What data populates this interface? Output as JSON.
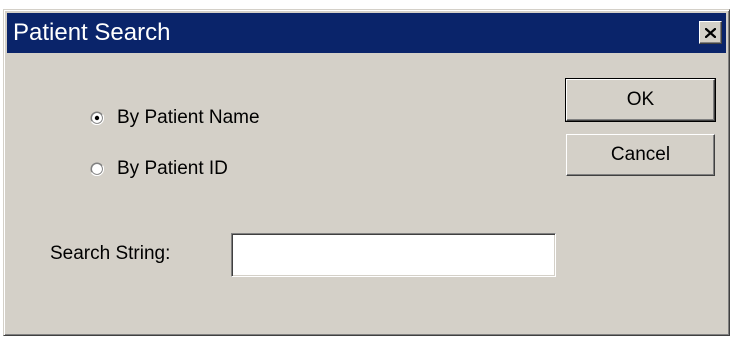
{
  "window": {
    "title": "Patient Search",
    "close_icon": "close-icon"
  },
  "search_mode": {
    "options": [
      {
        "label": "By Patient Name",
        "selected": true
      },
      {
        "label": "By Patient ID",
        "selected": false
      }
    ]
  },
  "search": {
    "label": "Search String:",
    "value": "",
    "placeholder": ""
  },
  "buttons": {
    "ok_label": "OK",
    "cancel_label": "Cancel"
  },
  "colors": {
    "titlebar": "#0a246a",
    "face": "#d4d0c8"
  }
}
